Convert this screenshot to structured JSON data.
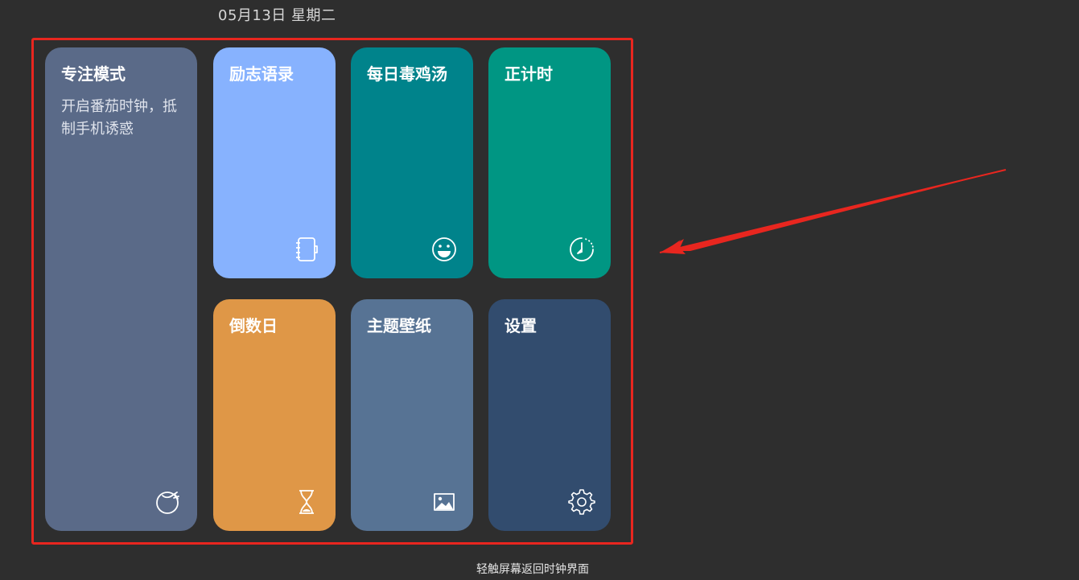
{
  "header": {
    "date_text": "05月13日 星期二"
  },
  "tiles": [
    {
      "title": "专注模式",
      "subtitle": "开启番茄时钟，抵制手机诱惑",
      "color": "#5a6a88",
      "icon": "tomato-icon"
    },
    {
      "title": "励志语录",
      "color": "#87b2fe",
      "icon": "notebook-icon"
    },
    {
      "title": "每日毒鸡汤",
      "color": "#00838b",
      "icon": "smiley-icon"
    },
    {
      "title": "正计时",
      "color": "#009683",
      "icon": "stopwatch-icon"
    },
    {
      "title": "倒数日",
      "color": "#df9747",
      "icon": "hourglass-icon"
    },
    {
      "title": "主题壁纸",
      "color": "#577394",
      "icon": "image-icon"
    },
    {
      "title": "设置",
      "color": "#324c6e",
      "icon": "gear-icon"
    }
  ],
  "footer": {
    "hint": "轻触屏幕返回时钟界面"
  },
  "annotation": {
    "frame_color": "#e8261f",
    "arrow_color": "#e8261f"
  }
}
